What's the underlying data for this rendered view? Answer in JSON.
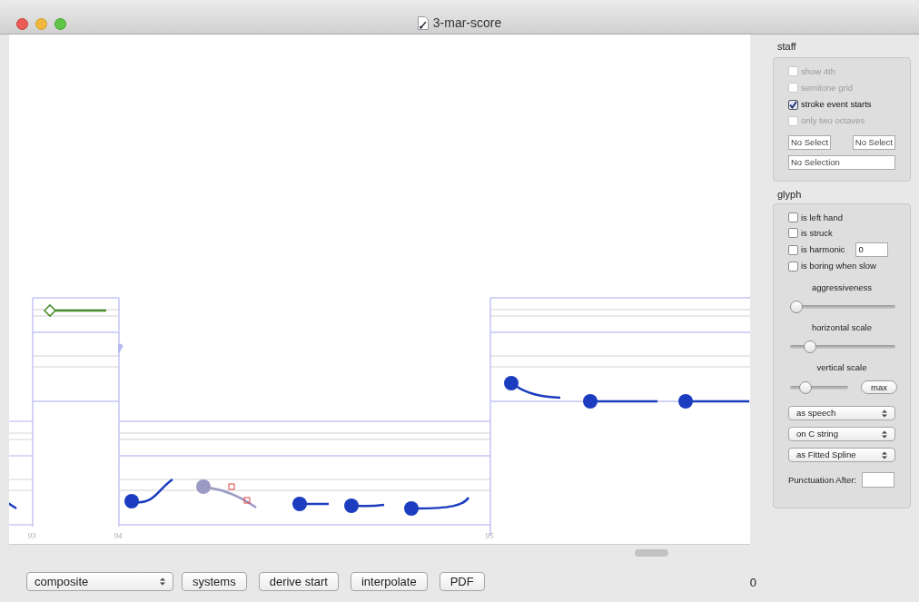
{
  "window": {
    "title": "3-mar-score"
  },
  "score": {
    "bar_numbers": [
      "93",
      "94",
      "95"
    ]
  },
  "staff": {
    "title": "staff",
    "checkboxes": [
      {
        "label": "show 4th",
        "checked": false,
        "disabled": true
      },
      {
        "label": "semitone grid",
        "checked": false,
        "disabled": true
      },
      {
        "label": "stroke event starts",
        "checked": true,
        "disabled": false
      },
      {
        "label": "only two octaves",
        "checked": false,
        "disabled": true
      }
    ],
    "fields": [
      "No Select",
      "No Select"
    ],
    "wide_field": "No Selection"
  },
  "glyph": {
    "title": "glyph",
    "checkboxes": [
      {
        "label": "is left hand",
        "checked": false
      },
      {
        "label": "is struck",
        "checked": false
      },
      {
        "label": "is harmonic",
        "checked": false,
        "value": "0"
      },
      {
        "label": "is boring when slow",
        "checked": false
      }
    ],
    "sliders": [
      {
        "label": "aggressiveness",
        "level": 0
      },
      {
        "label": "horizontal scale",
        "level": 0.15
      },
      {
        "label": "vertical scale",
        "level": 0.2,
        "button": "max"
      }
    ],
    "popups": [
      "as speech",
      "on C string",
      "as Fitted Spline"
    ],
    "punctuation_label": "Punctuation After:"
  },
  "bottom": {
    "popup": "composite",
    "buttons": [
      "systems",
      "derive start",
      "interpolate",
      "PDF"
    ],
    "count": "0"
  }
}
